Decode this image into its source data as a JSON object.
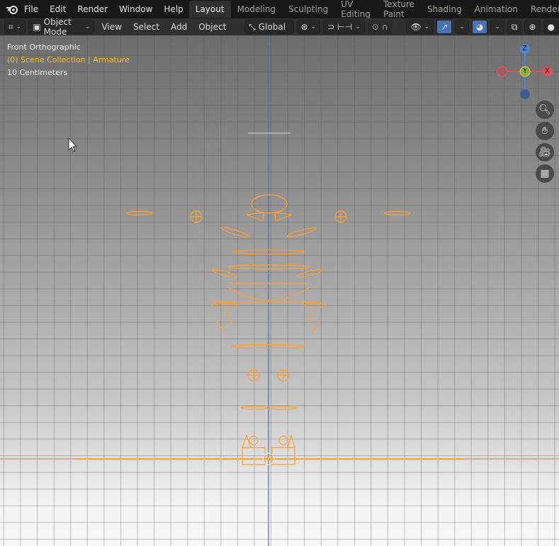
{
  "menus": [
    "File",
    "Edit",
    "Render",
    "Window",
    "Help"
  ],
  "workspaces": [
    "Layout",
    "Modeling",
    "Sculpting",
    "UV Editing",
    "Texture Paint",
    "Shading",
    "Animation",
    "Rendering"
  ],
  "active_workspace": "Layout",
  "header": {
    "mode": "Object Mode",
    "menus": [
      "View",
      "Select",
      "Add",
      "Object"
    ],
    "orientation": "Global"
  },
  "viewport": {
    "view_name": "Front Orthographic",
    "collection": "(0) Scene Collection | Armature",
    "scale": "10 Centimeters"
  },
  "gizmo": {
    "z": "Z",
    "y": "Y",
    "x": "X"
  },
  "colors": {
    "accent": "#4772b3",
    "selection": "#ffa030",
    "collection_text": "#f0c020",
    "x_axis": "#e0505a",
    "y_axis": "#8cb030",
    "z_axis": "#4a86d8"
  }
}
